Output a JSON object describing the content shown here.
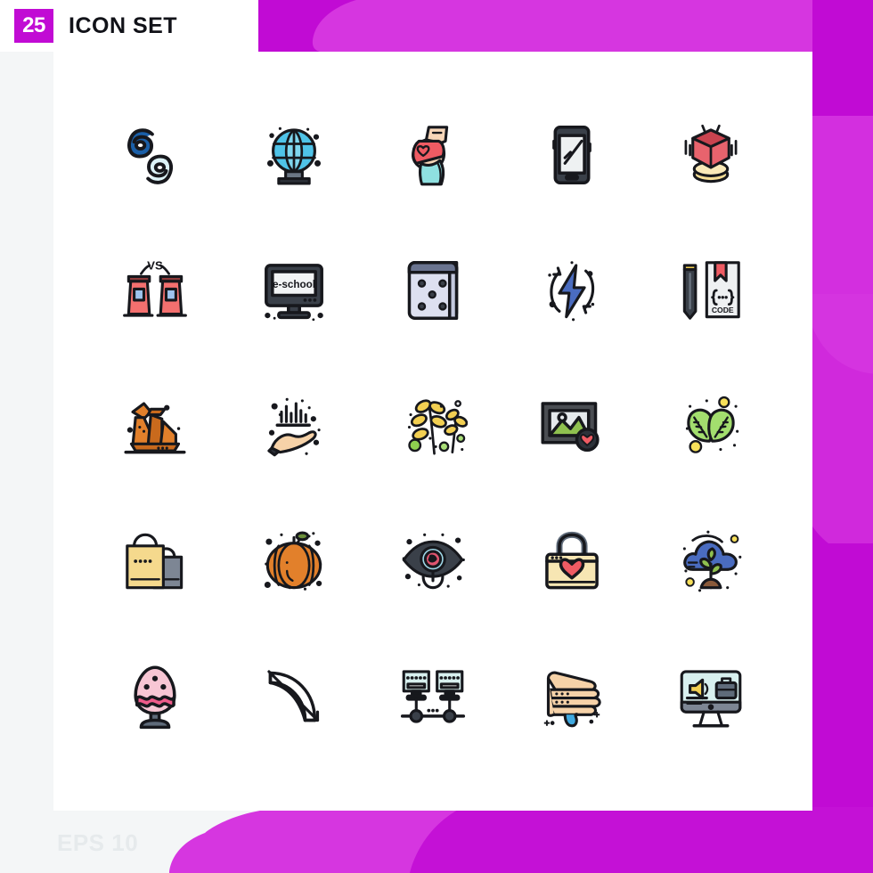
{
  "header": {
    "count_badge": "25",
    "title": "ICON SET",
    "badge_color": "#c10bd4"
  },
  "footer": {
    "format_label": "EPS 10"
  },
  "theme": {
    "page_background": "#f4f6f7",
    "card_background": "#ffffff",
    "accent_magenta": "#c10bd4",
    "accent_magenta_light": "#d636e0",
    "outline": "#17181d"
  },
  "grid": {
    "columns": 5,
    "rows": 5,
    "total_icons": 25
  },
  "icons": [
    {
      "index": 1,
      "row": 1,
      "col": 1,
      "name": "numbers-sixty-nine-icon",
      "label": "69 Numbers",
      "colors": [
        "#1a5fa8",
        "#d8f1f7"
      ]
    },
    {
      "index": 2,
      "row": 1,
      "col": 2,
      "name": "globe-stand-icon",
      "label": "Globe",
      "colors": [
        "#35b8d8",
        "#57c8e0",
        "#5f6b7a"
      ]
    },
    {
      "index": 3,
      "row": 1,
      "col": 3,
      "name": "pregnancy-icon",
      "label": "Pregnancy",
      "colors": [
        "#f6d2b3",
        "#ef5b63",
        "#8fe0e0"
      ]
    },
    {
      "index": 4,
      "row": 1,
      "col": 4,
      "name": "smartphone-icon",
      "label": "Smartphone",
      "colors": [
        "#3a4049",
        "#eceff1"
      ]
    },
    {
      "index": 5,
      "row": 1,
      "col": 5,
      "name": "hologram-cube-icon",
      "label": "Hologram Cube",
      "colors": [
        "#e8636d",
        "#c9434f",
        "#f5dd95"
      ]
    },
    {
      "index": 6,
      "row": 2,
      "col": 1,
      "name": "debate-podiums-vs-icon",
      "label": "Debate",
      "text": "VS",
      "colors": [
        "#f4706f",
        "#8e3b3b",
        "#9fc4ef"
      ]
    },
    {
      "index": 7,
      "row": 2,
      "col": 2,
      "name": "e-school-monitor-icon",
      "label": "E-School",
      "text": "e-school",
      "colors": [
        "#3a4049",
        "#f2f4f5"
      ]
    },
    {
      "index": 8,
      "row": 2,
      "col": 3,
      "name": "dice-five-icon",
      "label": "Dice",
      "pips": 5,
      "colors": [
        "#dde0f0",
        "#5f6b8a"
      ]
    },
    {
      "index": 9,
      "row": 2,
      "col": 4,
      "name": "renewable-energy-bolt-icon",
      "label": "Renewable Energy",
      "colors": [
        "#4a6cc0",
        "#17181d"
      ]
    },
    {
      "index": 10,
      "row": 2,
      "col": 5,
      "name": "code-book-pencil-icon",
      "label": "Code Book",
      "text": "CODE",
      "subtext": "{...}",
      "colors": [
        "#3a4049",
        "#ef5b63",
        "#eef0f2"
      ]
    },
    {
      "index": 11,
      "row": 3,
      "col": 1,
      "name": "origami-swan-icon",
      "label": "Origami Swan",
      "colors": [
        "#e2802b",
        "#c96a1d"
      ]
    },
    {
      "index": 12,
      "row": 3,
      "col": 2,
      "name": "hand-chart-icon",
      "label": "Hand Analytics",
      "colors": [
        "#f6d2a8",
        "#17181d"
      ]
    },
    {
      "index": 13,
      "row": 3,
      "col": 3,
      "name": "wheat-grain-icon",
      "label": "Wheat",
      "colors": [
        "#f2cf52",
        "#8fd14f"
      ]
    },
    {
      "index": 14,
      "row": 3,
      "col": 4,
      "name": "favorite-photo-icon",
      "label": "Favorite Photo",
      "colors": [
        "#4a4d52",
        "#8fc04f",
        "#ef5b63"
      ]
    },
    {
      "index": 15,
      "row": 3,
      "col": 5,
      "name": "eco-leaves-icon",
      "label": "Eco Leaves",
      "colors": [
        "#a3de6e",
        "#f7e05a"
      ]
    },
    {
      "index": 16,
      "row": 4,
      "col": 1,
      "name": "shopping-bags-icon",
      "label": "Shopping Bags",
      "colors": [
        "#f5d98d",
        "#7d8694"
      ]
    },
    {
      "index": 17,
      "row": 4,
      "col": 2,
      "name": "pumpkin-icon",
      "label": "Pumpkin",
      "colors": [
        "#e2802b",
        "#6b8f3a"
      ]
    },
    {
      "index": 18,
      "row": 4,
      "col": 3,
      "name": "eye-vision-icon",
      "label": "Eye",
      "colors": [
        "#3a4049",
        "#9fd8e8",
        "#e05570"
      ]
    },
    {
      "index": 19,
      "row": 4,
      "col": 4,
      "name": "favorite-lock-icon",
      "label": "Secure Favorite",
      "colors": [
        "#f7e6b3",
        "#5f6b7a",
        "#ef5b63"
      ]
    },
    {
      "index": 20,
      "row": 4,
      "col": 5,
      "name": "cloud-sprout-icon",
      "label": "Cloud Eco",
      "colors": [
        "#4a6cc0",
        "#8fc04f",
        "#8a5a3a"
      ]
    },
    {
      "index": 21,
      "row": 5,
      "col": 1,
      "name": "easter-egg-icon",
      "label": "Easter Egg",
      "colors": [
        "#f7c6d4",
        "#ef5b8a",
        "#5f6b7a"
      ]
    },
    {
      "index": 22,
      "row": 5,
      "col": 2,
      "name": "bow-arrow-icon",
      "label": "Bow and Arrow",
      "colors": [
        "#17181d"
      ]
    },
    {
      "index": 23,
      "row": 5,
      "col": 3,
      "name": "computer-network-icon",
      "label": "Computer Network",
      "colors": [
        "#d8f0ef",
        "#17181d"
      ]
    },
    {
      "index": 24,
      "row": 5,
      "col": 4,
      "name": "hand-washing-icon",
      "label": "Hand Washing",
      "colors": [
        "#f6d2a8",
        "#3fa9e0"
      ]
    },
    {
      "index": 25,
      "row": 5,
      "col": 5,
      "name": "job-advertisement-monitor-icon",
      "label": "Job Advertisement",
      "colors": [
        "#d8f0ef",
        "#5f6b7a",
        "#f7e05a"
      ]
    }
  ]
}
